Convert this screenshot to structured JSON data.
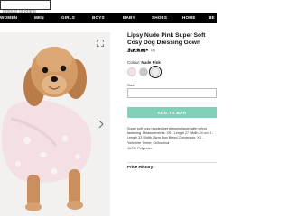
{
  "search": {
    "placeholder": "product or brand"
  },
  "nav": {
    "items": [
      {
        "label": "WOMEN"
      },
      {
        "label": "MEN"
      },
      {
        "label": "GIRLS"
      },
      {
        "label": "BOYS"
      },
      {
        "label": "BABY"
      },
      {
        "label": "SHOES"
      },
      {
        "label": "HOME"
      },
      {
        "label": "BE"
      }
    ]
  },
  "product": {
    "title": "Lipsy Nude Pink Super Soft Cosy Dog Dressing Gown Jacket",
    "rating_stars": "★★★★★",
    "rating_count": "(8)",
    "colour_label": "Colour:",
    "colour_value": "Nude Pink",
    "swatches": [
      {
        "color": "#f3dfe4"
      },
      {
        "color": "#c9c7c5"
      },
      {
        "color": "#f2eeec",
        "selected": true
      }
    ],
    "size_label": "Size",
    "add_button": "ADD TO BAG",
    "description": "Super soft cosy hooded pet dressing gown with velcro fastening. Measurements: XS - Length 27 Width 24 cm S - Length 33 Width 28cm Dog Breed Conversion: XS - Yorkshire Terrier, Chihuahua",
    "fabric": "100% Polyester.",
    "price_history": "Price History"
  },
  "colors": {
    "accent": "#7fd2b9",
    "nav_bg": "#000000"
  }
}
